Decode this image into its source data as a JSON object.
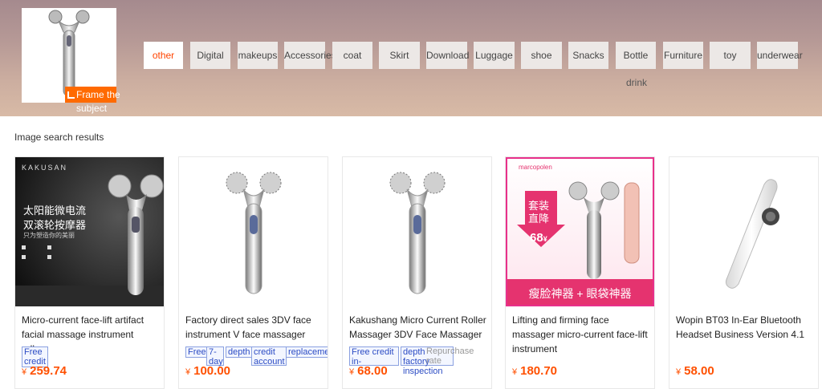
{
  "frame_button": {
    "line1": "Frame the",
    "line2": "subject"
  },
  "categories": [
    {
      "label": "other",
      "active": true
    },
    {
      "label": "Digital"
    },
    {
      "label": "makeups"
    },
    {
      "label": "Accessories"
    },
    {
      "label": "coat"
    },
    {
      "label": "Skirt"
    },
    {
      "label": "Download"
    },
    {
      "label": "Luggage"
    },
    {
      "label": "shoe"
    },
    {
      "label": "Snacks"
    },
    {
      "label": "Bottle"
    },
    {
      "label": "Furniture"
    },
    {
      "label": "toy"
    },
    {
      "label": "underwear"
    }
  ],
  "category_sub": "drink",
  "results_title": "Image search results",
  "currency": "¥",
  "products": [
    {
      "title": "Micro-current face-lift artifact facial massage instrument roller-",
      "tags": [
        "Free credit"
      ],
      "price": "259.74",
      "brand_text": "KAKUSAN",
      "cn_line1": "太阳能微电流",
      "cn_line2": "双滚轮按摩器",
      "cn_line3": "只为塑造你的美丽"
    },
    {
      "title": "Factory direct sales 3DV face instrument V face massager",
      "tags": [
        "Free",
        "7-day",
        "depth",
        "credit account",
        "replacement"
      ],
      "price": "100.00"
    },
    {
      "title": "Kakushang Micro Current Roller Massager 3DV Face Massager",
      "tags": [
        "Free credit in-",
        "depth factory inspection",
        "Repurchase rate"
      ],
      "price": "68.00"
    },
    {
      "title": "Lifting and firming face massager micro-current face-lift instrument",
      "tags": [],
      "price": "180.70",
      "brand_text": "marcopolen",
      "promo_line1": "套装",
      "promo_line2": "直降",
      "promo_price": "68",
      "bottom_text": "瘦脸神器 + 眼袋神器"
    },
    {
      "title": "Wopin BT03 In-Ear Bluetooth Headset Business Version 4.1",
      "tags": [],
      "price": "58.00"
    }
  ]
}
